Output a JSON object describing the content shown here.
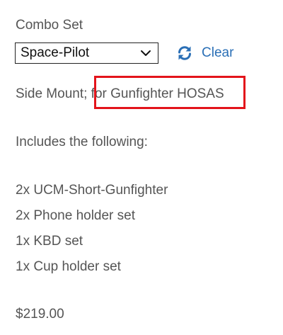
{
  "combo": {
    "label": "Combo Set",
    "selected": "Space-Pilot",
    "clear_label": "Clear"
  },
  "description": {
    "mount_prefix": "Side Mount;",
    "mount_highlight": " for Gunfighter HOSAS",
    "includes_heading": "Includes the following:",
    "items": [
      "2x UCM-Short-Gunfighter",
      "2x Phone holder set",
      "1x KBD set",
      "1x Cup holder set"
    ]
  },
  "price": "$219.00",
  "colors": {
    "accent": "#2a6fb6",
    "highlight_box": "#e3141b",
    "text": "#555555"
  },
  "icons": {
    "dropdown": "chevron-down-icon",
    "clear": "refresh-icon"
  }
}
